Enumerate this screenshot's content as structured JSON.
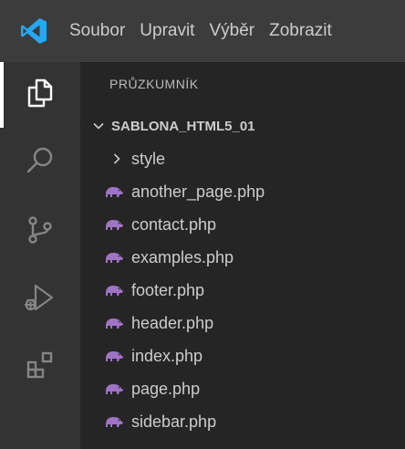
{
  "menu": {
    "items": [
      "Soubor",
      "Upravit",
      "Výběr",
      "Zobrazit"
    ]
  },
  "activitybar": {
    "items": [
      {
        "icon": "files-icon",
        "active": true
      },
      {
        "icon": "search-icon",
        "active": false
      },
      {
        "icon": "source-control-icon",
        "active": false
      },
      {
        "icon": "run-debug-icon",
        "active": false
      },
      {
        "icon": "extensions-icon",
        "active": false
      }
    ]
  },
  "explorer": {
    "title": "PRŮZKUMNÍK",
    "folder": "SABLONA_HTML5_01",
    "subfolder": "style",
    "files": [
      "another_page.php",
      "contact.php",
      "examples.php",
      "footer.php",
      "header.php",
      "index.php",
      "page.php",
      "sidebar.php"
    ]
  },
  "colors": {
    "accent_blue": "#23a9f2",
    "php_icon": "#a074c4",
    "text": "#cccccc",
    "icon_gray": "#858585"
  }
}
